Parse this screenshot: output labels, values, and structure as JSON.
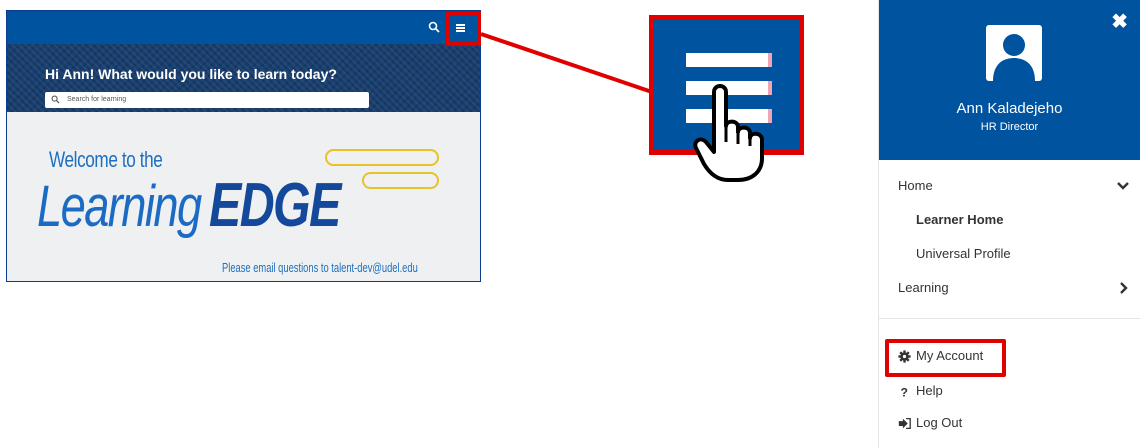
{
  "app": {
    "greeting": "Hi Ann! What would you like to learn today?",
    "search_placeholder": "Search for learning",
    "banner": {
      "welcome": "Welcome to the",
      "title_part1": "Learning",
      "title_part2": "EDGE",
      "email_note": "Please email questions to talent-dev@udel.edu"
    },
    "icons": {
      "search": "search-icon",
      "menu": "hamburger-menu-icon"
    }
  },
  "callout": {
    "icon": "hamburger-menu-icon",
    "cursor": "hand-pointer-icon"
  },
  "panel": {
    "close_label": "✖",
    "user_name": "Ann Kaladejeho",
    "user_title": "HR Director",
    "nav": {
      "home": "Home",
      "learner_home": "Learner Home",
      "universal_profile": "Universal Profile",
      "learning": "Learning",
      "my_account": "My Account",
      "help": "Help",
      "log_out": "Log Out"
    }
  },
  "colors": {
    "brand_blue": "#00539f",
    "highlight_red": "#e00000",
    "accent_yellow": "#e8c227"
  }
}
